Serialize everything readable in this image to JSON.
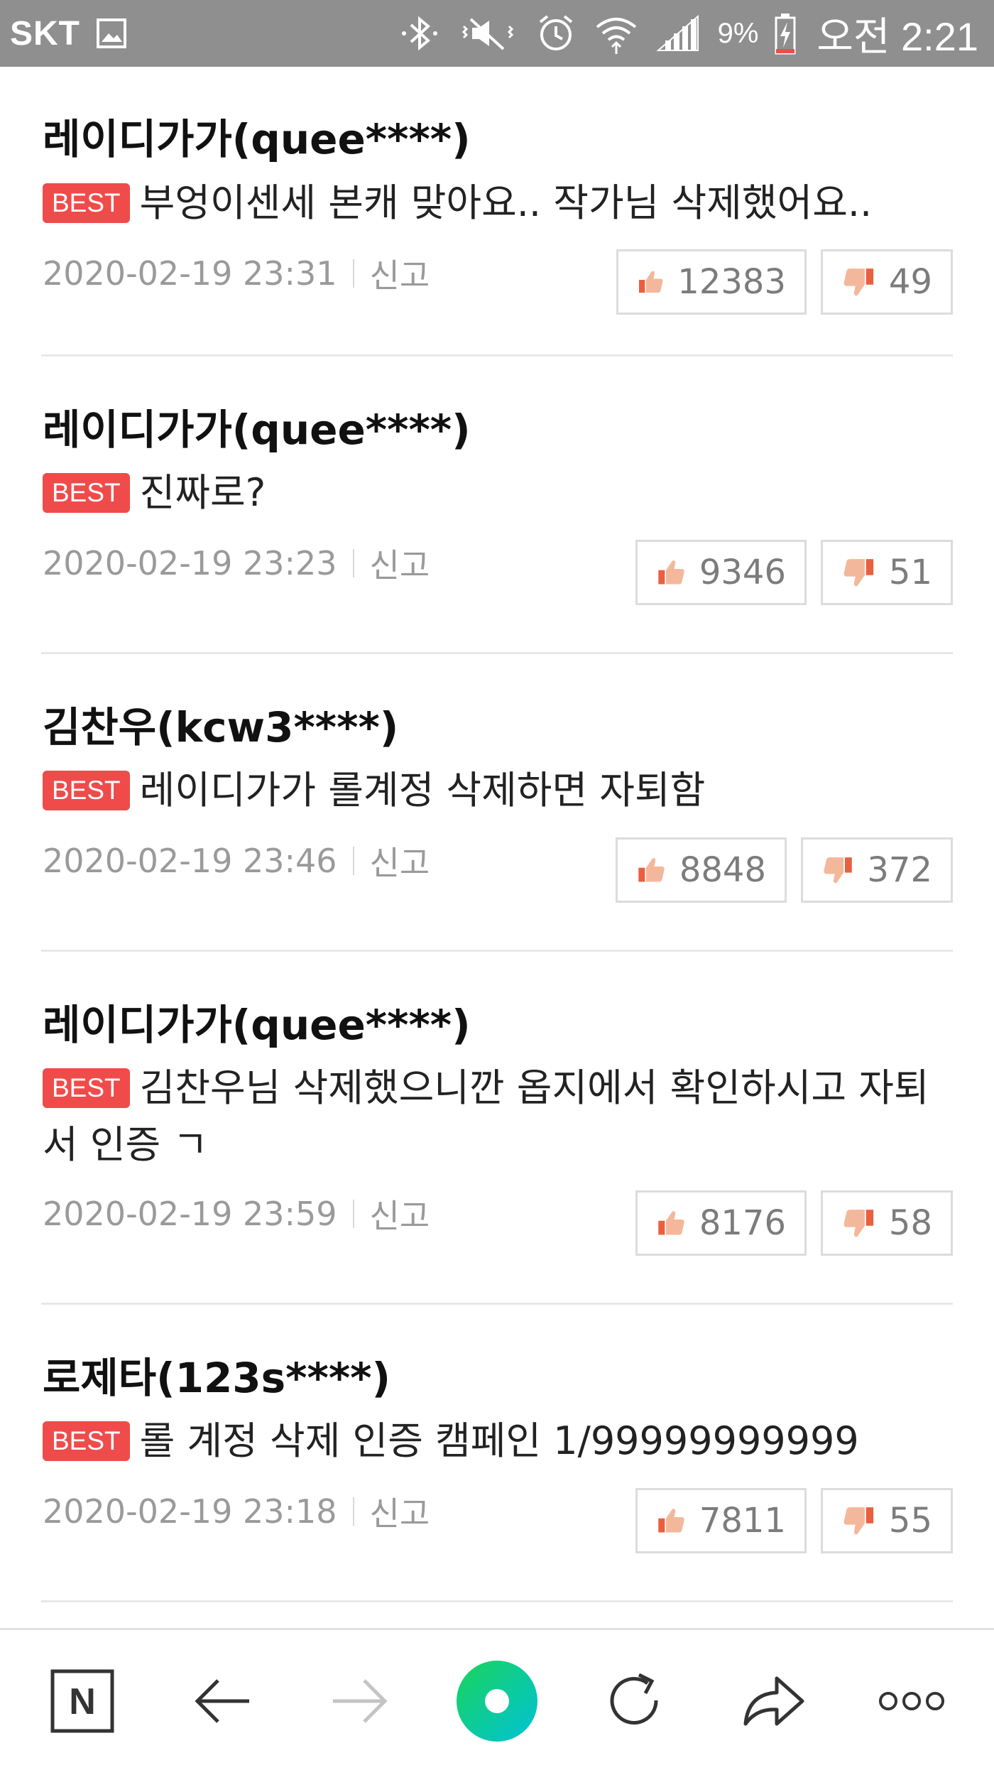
{
  "status_bar": {
    "carrier": "SKT",
    "battery": "9%",
    "clock": "오전 2:21",
    "icons": [
      "gallery-icon",
      "bluetooth-icon",
      "vibrate-mute-icon",
      "alarm-icon",
      "wifi-icon",
      "signal-icon",
      "battery-charging-icon"
    ]
  },
  "best_label": "BEST",
  "report_label": "신고",
  "comments": [
    {
      "author": "레이디가가(quee****)",
      "text": "부엉이센세 본캐 맞아요.. 작가님 삭제했어요..",
      "date": "2020-02-19 23:31",
      "likes": "12383",
      "dislikes": "49"
    },
    {
      "author": "레이디가가(quee****)",
      "text": "진짜로?",
      "date": "2020-02-19 23:23",
      "likes": "9346",
      "dislikes": "51"
    },
    {
      "author": "김찬우(kcw3****)",
      "text": "레이디가가 롤계정 삭제하면 자퇴함",
      "date": "2020-02-19 23:46",
      "likes": "8848",
      "dislikes": "372"
    },
    {
      "author": "레이디가가(quee****)",
      "text": "김찬우님 삭제했으니깐 옵지에서 확인하시고 자퇴서 인증 ㄱ",
      "date": "2020-02-19 23:59",
      "likes": "8176",
      "dislikes": "58"
    },
    {
      "author": "로제타(123s****)",
      "text": "롤 계정 삭제 인증 캠페인 1/99999999999",
      "date": "2020-02-19 23:18",
      "likes": "7811",
      "dislikes": "55"
    }
  ],
  "bottom_nav": {
    "items": [
      "naver-home-icon",
      "back-arrow-icon",
      "forward-arrow-icon",
      "green-dot-icon",
      "refresh-icon",
      "share-icon",
      "more-icon"
    ],
    "home_letter": "N",
    "accent": "#19ce60",
    "accent2": "#00c3d6"
  },
  "colors": {
    "best_badge": "#f04b4b",
    "status_bar": "#8f8f8f"
  }
}
